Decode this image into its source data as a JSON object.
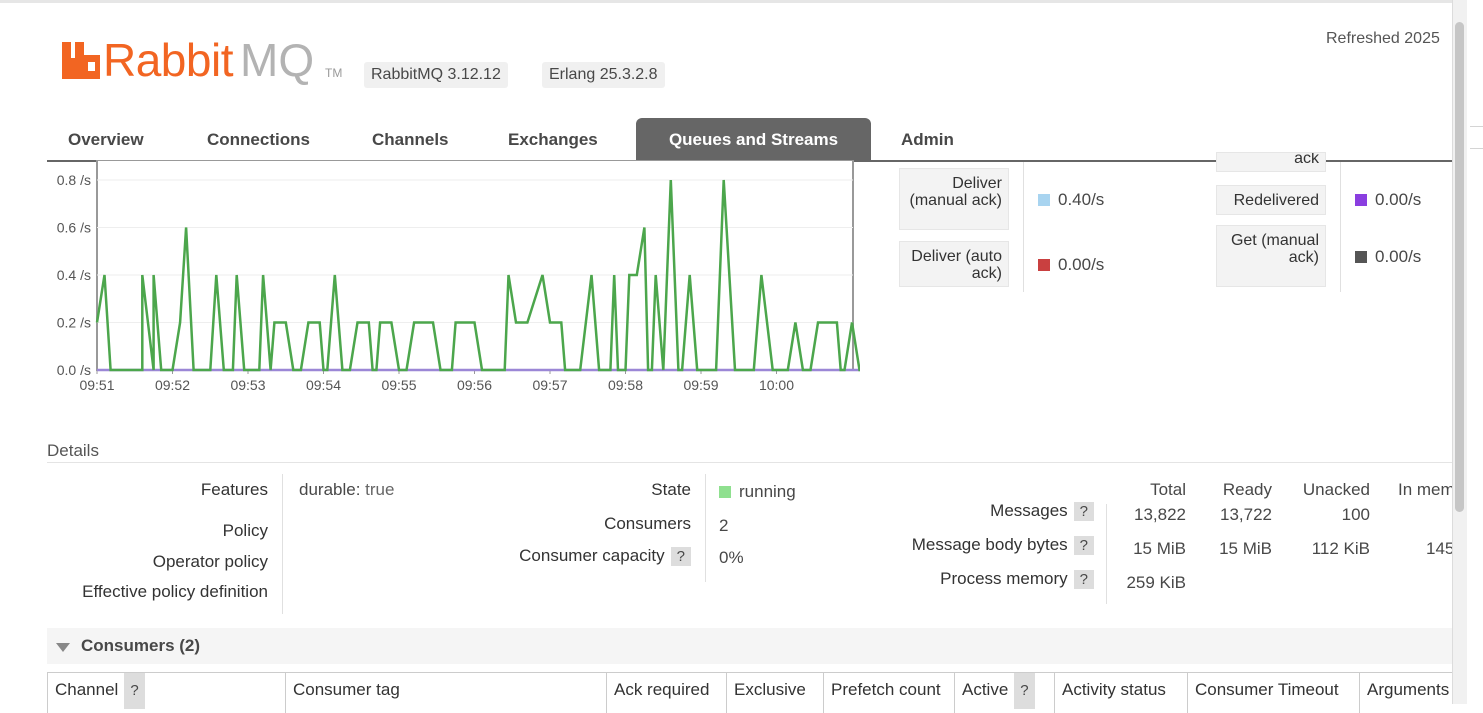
{
  "header": {
    "logo_text_primary": "Rabbit",
    "logo_text_secondary": "MQ",
    "logo_tm": "TM",
    "rabbitmq_version": "RabbitMQ 3.12.12",
    "erlang_version": "Erlang 25.3.2.8",
    "refreshed": "Refreshed 2025"
  },
  "tabs": [
    {
      "label": "Overview",
      "active": false
    },
    {
      "label": "Connections",
      "active": false
    },
    {
      "label": "Channels",
      "active": false
    },
    {
      "label": "Exchanges",
      "active": false
    },
    {
      "label": "Queues and Streams",
      "active": true
    },
    {
      "label": "Admin",
      "active": false
    }
  ],
  "chart_data": {
    "type": "line",
    "x": [
      "09:51",
      "09:52",
      "09:53",
      "09:54",
      "09:55",
      "09:56",
      "09:57",
      "09:58",
      "09:59",
      "10:00"
    ],
    "yticks": [
      "0.0 /s",
      "0.2 /s",
      "0.4 /s",
      "0.6 /s",
      "0.8 /s"
    ],
    "ylim": [
      0,
      0.8
    ],
    "xlim_minutes": [
      0,
      10
    ],
    "series": [
      {
        "color": "#4ca64c",
        "points": [
          [
            0.0,
            0.2
          ],
          [
            0.1,
            0.4
          ],
          [
            0.18,
            0
          ],
          [
            0.6,
            0
          ],
          [
            0.6,
            0.4
          ],
          [
            0.75,
            0
          ],
          [
            0.75,
            0.4
          ],
          [
            0.85,
            0
          ],
          [
            1.0,
            0
          ],
          [
            1.1,
            0.2
          ],
          [
            1.18,
            0.6
          ],
          [
            1.28,
            0
          ],
          [
            1.5,
            0
          ],
          [
            1.58,
            0.4
          ],
          [
            1.68,
            0
          ],
          [
            1.8,
            0
          ],
          [
            1.85,
            0.4
          ],
          [
            1.95,
            0
          ],
          [
            2.15,
            0
          ],
          [
            2.2,
            0.4
          ],
          [
            2.3,
            0
          ],
          [
            2.35,
            0.2
          ],
          [
            2.5,
            0.2
          ],
          [
            2.6,
            0
          ],
          [
            2.7,
            0
          ],
          [
            2.8,
            0.2
          ],
          [
            2.95,
            0.2
          ],
          [
            3.0,
            0
          ],
          [
            3.05,
            0
          ],
          [
            3.15,
            0.4
          ],
          [
            3.25,
            0
          ],
          [
            3.35,
            0
          ],
          [
            3.45,
            0.2
          ],
          [
            3.6,
            0.2
          ],
          [
            3.65,
            0
          ],
          [
            3.7,
            0
          ],
          [
            3.75,
            0.2
          ],
          [
            3.9,
            0.2
          ],
          [
            4.0,
            0
          ],
          [
            4.1,
            0
          ],
          [
            4.2,
            0.2
          ],
          [
            4.45,
            0.2
          ],
          [
            4.55,
            0
          ],
          [
            4.7,
            0
          ],
          [
            4.75,
            0.2
          ],
          [
            5.0,
            0.2
          ],
          [
            5.1,
            0
          ],
          [
            5.4,
            0
          ],
          [
            5.45,
            0.4
          ],
          [
            5.55,
            0.2
          ],
          [
            5.7,
            0.2
          ],
          [
            5.9,
            0.4
          ],
          [
            6.0,
            0.2
          ],
          [
            6.15,
            0.2
          ],
          [
            6.2,
            0
          ],
          [
            6.4,
            0
          ],
          [
            6.55,
            0.4
          ],
          [
            6.65,
            0
          ],
          [
            6.8,
            0
          ],
          [
            6.85,
            0.4
          ],
          [
            6.9,
            0
          ],
          [
            7.0,
            0
          ],
          [
            7.05,
            0.4
          ],
          [
            7.15,
            0.4
          ],
          [
            7.25,
            0.6
          ],
          [
            7.3,
            0
          ],
          [
            7.35,
            0
          ],
          [
            7.4,
            0.4
          ],
          [
            7.5,
            0
          ],
          [
            7.6,
            0.8
          ],
          [
            7.7,
            0
          ],
          [
            7.75,
            0
          ],
          [
            7.85,
            0.4
          ],
          [
            7.95,
            0
          ],
          [
            8.2,
            0
          ],
          [
            8.3,
            0.8
          ],
          [
            8.45,
            0
          ],
          [
            8.7,
            0
          ],
          [
            8.8,
            0.4
          ],
          [
            8.95,
            0
          ],
          [
            9.15,
            0
          ],
          [
            9.25,
            0.2
          ],
          [
            9.35,
            0
          ],
          [
            9.45,
            0
          ],
          [
            9.55,
            0.2
          ],
          [
            9.8,
            0.2
          ],
          [
            9.85,
            0
          ],
          [
            9.9,
            0
          ],
          [
            10.0,
            0.2
          ],
          [
            10.1,
            0
          ],
          [
            10.3,
            0
          ],
          [
            10.35,
            0.2
          ],
          [
            10.5,
            0.2
          ],
          [
            10.6,
            0
          ],
          [
            10.75,
            0
          ],
          [
            10.9,
            0.4
          ],
          [
            11.05,
            0.8
          ],
          [
            11.2,
            0.4
          ],
          [
            11.45,
            0.4
          ],
          [
            11.65,
            0.4
          ],
          [
            11.7,
            0
          ],
          [
            11.9,
            0
          ],
          [
            12.0,
            0.2
          ],
          [
            12.05,
            0
          ],
          [
            12.15,
            0
          ],
          [
            12.25,
            0.2
          ],
          [
            12.35,
            0
          ],
          [
            12.45,
            0
          ],
          [
            12.55,
            0.2
          ],
          [
            12.75,
            0.2
          ],
          [
            12.85,
            0
          ],
          [
            13.0,
            0
          ],
          [
            13.1,
            0.2
          ],
          [
            13.25,
            0.2
          ],
          [
            13.3,
            0.4
          ],
          [
            13.35,
            0.4
          ]
        ]
      },
      {
        "color": "#9b87d6",
        "points": [
          [
            0,
            0
          ],
          [
            13.35,
            0
          ]
        ]
      }
    ]
  },
  "rates": {
    "cut_label": "ack",
    "deliver_manual": {
      "label": "Deliver (manual ack)",
      "value": "0.40/s",
      "color": "#a8d4f0"
    },
    "deliver_auto": {
      "label": "Deliver (auto ack)",
      "value": "0.00/s",
      "color": "#c94040"
    },
    "redelivered": {
      "label": "Redelivered",
      "value": "0.00/s",
      "color": "#8a3ee0"
    },
    "get_manual": {
      "label": "Get (manual ack)",
      "value": "0.00/s",
      "color": "#555555"
    }
  },
  "details": {
    "title": "Details",
    "features_label": "Features",
    "durable_key": "durable:",
    "durable_value": "true",
    "policy_label": "Policy",
    "operator_policy_label": "Operator policy",
    "effective_policy_label": "Effective policy definition",
    "state_label": "State",
    "state_value": "running",
    "state_color": "#8fe08f",
    "consumers_label": "Consumers",
    "consumers_value": "2",
    "consumer_capacity_label": "Consumer capacity",
    "consumer_capacity_value": "0%",
    "help": "?",
    "stats_headers": [
      "Total",
      "Ready",
      "Unacked",
      "In memory"
    ],
    "messages_label": "Messages",
    "messages_values": [
      "13,822",
      "13,722",
      "100",
      ""
    ],
    "body_bytes_label": "Message body bytes",
    "body_bytes_values": [
      "15 MiB",
      "15 MiB",
      "112 KiB",
      "145"
    ],
    "process_memory_label": "Process memory",
    "process_memory_value": "259 KiB"
  },
  "consumers": {
    "title": "Consumers (2)",
    "columns": [
      "Channel",
      "Consumer tag",
      "Ack required",
      "Exclusive",
      "Prefetch count",
      "Active",
      "Activity status",
      "Consumer Timeout",
      "Arguments"
    ],
    "help": "?"
  }
}
